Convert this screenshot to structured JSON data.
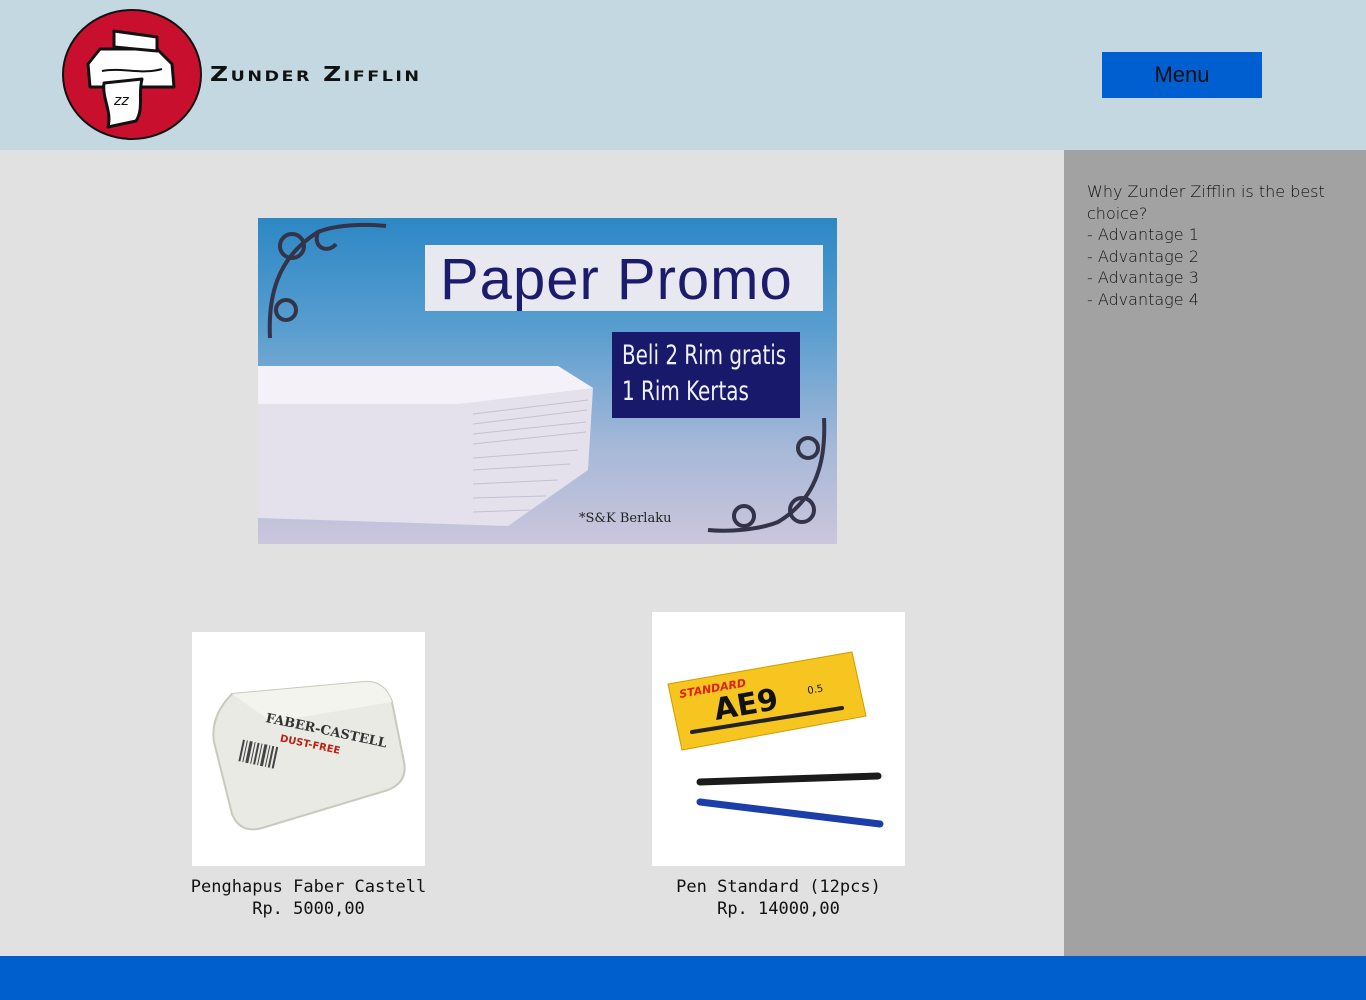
{
  "header": {
    "brand_name": "Zunder Zifflin",
    "menu_label": "Menu"
  },
  "banner": {
    "title": "Paper Promo",
    "offer_line1": "Beli 2 Rim gratis",
    "offer_line2": "1 Rim Kertas",
    "note": "*S&K Berlaku"
  },
  "aside": {
    "heading": "Why Zunder Zifflin is the best choice?",
    "items": [
      "- Advantage 1",
      "- Advantage 2",
      "- Advantage 3",
      "- Advantage 4"
    ]
  },
  "products": [
    {
      "name": "Penghapus Faber Castell",
      "price": "Rp. 5000,00",
      "brand_print": "FABER-CASTELL",
      "tag": "DUST-FREE"
    },
    {
      "name": "Pen Standard (12pcs)",
      "price": "Rp. 14000,00",
      "brand_print": "STANDARD",
      "model": "AE9",
      "size": "0.5"
    }
  ],
  "colors": {
    "header_bg": "#c3d8e1",
    "main_bg": "#e1e1e1",
    "aside_bg": "#a2a2a2",
    "accent": "#005fd0",
    "logo_red": "#c8102e"
  }
}
